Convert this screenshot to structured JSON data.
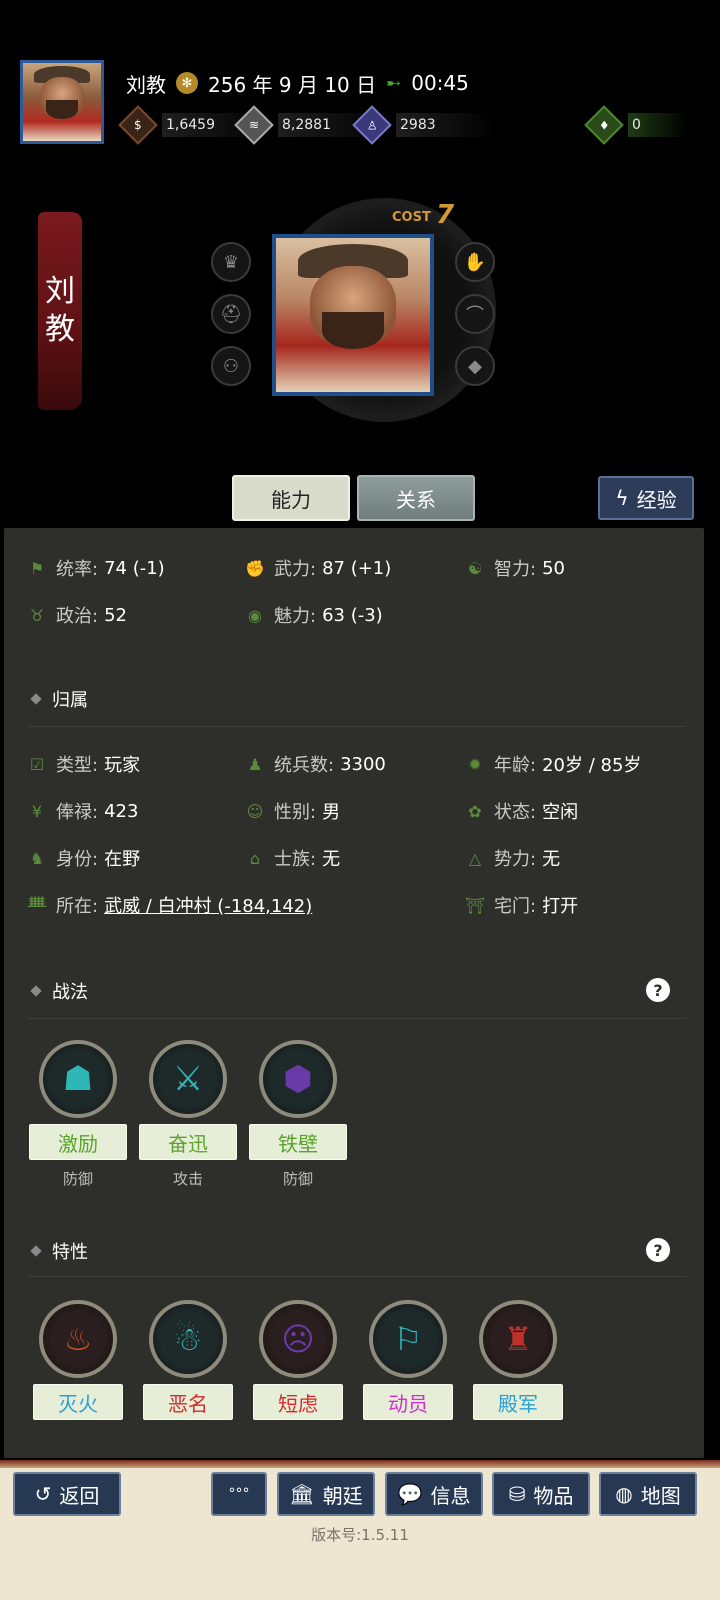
{
  "header": {
    "name": "刘教",
    "date": "256 年 9 月 10 日",
    "time": "00:45",
    "resources": [
      {
        "icon": "coin-icon",
        "value": "1,6459"
      },
      {
        "icon": "grain-icon",
        "value": "8,2881"
      },
      {
        "icon": "soldier-icon",
        "value": "2983"
      },
      {
        "icon": "pouch-icon",
        "value": "0"
      }
    ]
  },
  "portrait": {
    "banner_chars": [
      "刘",
      "教"
    ],
    "cost_label": "COST",
    "cost_value": "7"
  },
  "tabs": {
    "ability": "能力",
    "relation": "关系",
    "experience": "经验"
  },
  "stats": [
    {
      "label": "统率:",
      "value": "74 (-1)"
    },
    {
      "label": "武力:",
      "value": "87 (+1)"
    },
    {
      "label": "智力:",
      "value": "50"
    },
    {
      "label": "政治:",
      "value": "52"
    },
    {
      "label": "魅力:",
      "value": "63 (-3)"
    }
  ],
  "affiliation": {
    "title": "归属",
    "items": [
      {
        "label": "类型:",
        "value": "玩家"
      },
      {
        "label": "统兵数:",
        "value": "3300"
      },
      {
        "label": "年龄:",
        "value": "20岁 / 85岁"
      },
      {
        "label": "俸禄:",
        "value": "423"
      },
      {
        "label": "性别:",
        "value": "男"
      },
      {
        "label": "状态:",
        "value": "空闲"
      },
      {
        "label": "身份:",
        "value": "在野"
      },
      {
        "label": "士族:",
        "value": "无"
      },
      {
        "label": "势力:",
        "value": "无"
      },
      {
        "label": "所在:",
        "value": "武威 / 白冲村 (-184,142)"
      },
      {
        "label": "宅门:",
        "value": "打开"
      }
    ]
  },
  "tactics": {
    "title": "战法",
    "help": "?",
    "items": [
      {
        "name": "激励",
        "type": "防御",
        "color": "#5ba32b",
        "icon": "demon-icon"
      },
      {
        "name": "奋迅",
        "type": "攻击",
        "color": "#5ba32b",
        "icon": "crossed-swords-icon"
      },
      {
        "name": "铁壁",
        "type": "防御",
        "color": "#5ba32b",
        "icon": "shield-icon"
      }
    ]
  },
  "traits": {
    "title": "特性",
    "help": "?",
    "items": [
      {
        "name": "灭火",
        "color": "#2a9fd6",
        "icon": "fire-icon"
      },
      {
        "name": "恶名",
        "color": "#d62a2a",
        "icon": "hooded-icon"
      },
      {
        "name": "短虑",
        "color": "#d62a2a",
        "icon": "mask-icon"
      },
      {
        "name": "动员",
        "color": "#d62ad6",
        "icon": "banner-icon"
      },
      {
        "name": "殿军",
        "color": "#2a9fd6",
        "icon": "armor-icon"
      }
    ]
  },
  "bottom_bar": {
    "back": "返回",
    "more": "°°°",
    "court": "朝廷",
    "info": "信息",
    "items": "物品",
    "map": "地图",
    "version": "版本号:1.5.11"
  }
}
